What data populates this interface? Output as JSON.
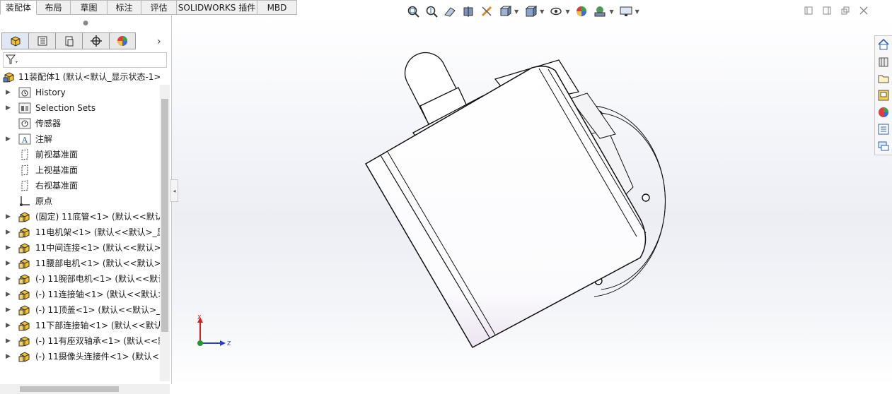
{
  "tabs": [
    "装配体",
    "布局",
    "草图",
    "标注",
    "评估",
    "SOLIDWORKS 插件",
    "MBD"
  ],
  "active_tab": "装配体",
  "panel_tabs": [
    "featuremanager-icon",
    "propertymanager-icon",
    "configurationmanager-icon",
    "dimxpert-icon",
    "display-manager-icon"
  ],
  "tree": {
    "root": "11装配体1  (默认<默认_显示状态-1>",
    "items": [
      {
        "label": "History",
        "icon": "history-icon",
        "expand": true
      },
      {
        "label": "Selection Sets",
        "icon": "selection-sets-icon",
        "expand": true
      },
      {
        "label": "传感器",
        "icon": "sensor-icon",
        "expand": false
      },
      {
        "label": "注解",
        "icon": "annotation-icon",
        "expand": true
      },
      {
        "label": "前视基准面",
        "icon": "plane-icon",
        "expand": false
      },
      {
        "label": "上视基准面",
        "icon": "plane-icon",
        "expand": false
      },
      {
        "label": "右视基准面",
        "icon": "plane-icon",
        "expand": false
      },
      {
        "label": "原点",
        "icon": "origin-icon",
        "expand": false
      },
      {
        "label": "(固定) 11底管<1> (默认<<默认",
        "icon": "part-icon",
        "expand": true
      },
      {
        "label": "11电机架<1> (默认<<默认>_显",
        "icon": "part-icon",
        "expand": true
      },
      {
        "label": "11中间连接<1> (默认<<默认>_",
        "icon": "part-icon",
        "expand": true
      },
      {
        "label": "11腰部电机<1> (默认<<默认>_",
        "icon": "part-icon",
        "expand": true
      },
      {
        "label": "(-) 11腕部电机<1> (默认<<默认",
        "icon": "part-icon",
        "expand": true
      },
      {
        "label": "(-) 11连接轴<1> (默认<<默认>",
        "icon": "part-icon",
        "expand": true
      },
      {
        "label": "(-) 11顶盖<1> (默认<<默认>_显",
        "icon": "part-icon",
        "expand": true
      },
      {
        "label": "11下部连接轴<1> (默认<<默认",
        "icon": "part-icon",
        "expand": true
      },
      {
        "label": "(-) 11有座双轴承<1> (默认<<默",
        "icon": "part-icon",
        "expand": true
      },
      {
        "label": "(-) 11摄像头连接件<1> (默认<<",
        "icon": "part-icon",
        "expand": true
      }
    ]
  },
  "triad": {
    "x_label": "X",
    "z_label": "Z"
  },
  "colors": {
    "accent": "#2a5fb0",
    "tab_border": "#b8b8b8",
    "axis_x": "#d42020",
    "axis_z": "#2a3fd0",
    "axis_y": "#1f9a2f"
  }
}
